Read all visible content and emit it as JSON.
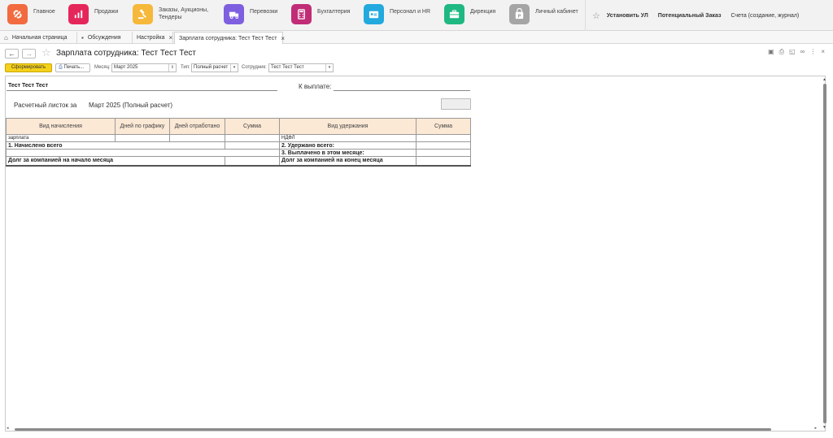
{
  "sections": [
    {
      "label": "Главное",
      "icon": "main-app-icon",
      "color": "#f26a3f"
    },
    {
      "label": "Продажи",
      "icon": "sales-chart-icon",
      "color": "#e5265a"
    },
    {
      "label": "Заказы, Аукционы, Тендеры",
      "icon": "gavel-icon",
      "color": "#f6b83a"
    },
    {
      "label": "Перевозки",
      "icon": "truck-icon",
      "color": "#7e5fe0"
    },
    {
      "label": "Бухгалтерия",
      "icon": "calculator-icon",
      "color": "#c02d76"
    },
    {
      "label": "Персонал и HR",
      "icon": "id-card-icon",
      "color": "#22a9de"
    },
    {
      "label": "Дирекция",
      "icon": "briefcase-icon",
      "color": "#1fb882"
    },
    {
      "label": "Личный кабинет",
      "icon": "parking-icon",
      "color": "#a5a5a5"
    }
  ],
  "top_right": {
    "item1": "Установить УЛ",
    "item2": "Потенциальный Заказ",
    "item3": "Счета (создание, журнал)"
  },
  "tabs": [
    {
      "label": "Начальная страница",
      "icon": "home-icon"
    },
    {
      "label": "Обсуждения",
      "icon": "chat-icon"
    },
    {
      "label": "Настройка"
    },
    {
      "label": "Зарплата сотрудника: Тест Тест Тест"
    }
  ],
  "title": "Зарплата сотрудника: Тест Тест Тест",
  "toolbar": {
    "form_button": "Сформировать",
    "print_button": "Печать...",
    "month_label": "Месяц:",
    "month_value": "Март 2025",
    "type_label": "Тип:",
    "type_value": "Полный расчет",
    "employee_label": "Сотрудник:",
    "employee_value": "Тест Тест Тест"
  },
  "report": {
    "employee": "Тест Тест Тест",
    "to_pay_label": "К выплате:",
    "slip_label": "Расчетный листок за",
    "slip_value": "Март 2025 (Полный расчет)",
    "headers": {
      "accrual_type": "Вид начисления",
      "days_schedule": "Дней по графику",
      "days_worked": "Дней отработано",
      "sum1": "Сумма",
      "deduction_type": "Вид удержания",
      "sum2": "Сумма"
    },
    "row1_accrual": "зарплата",
    "row1_deduction": "НДФЛ",
    "accrued_total": "1. Начислено всего",
    "withheld_total": "2. Удержано всего:",
    "paid_month": "3. Выплачено в этом месяце:",
    "debt_start": "Долг за компанией на начало месяца",
    "debt_end": "Долг за компанией на конец месяца"
  }
}
